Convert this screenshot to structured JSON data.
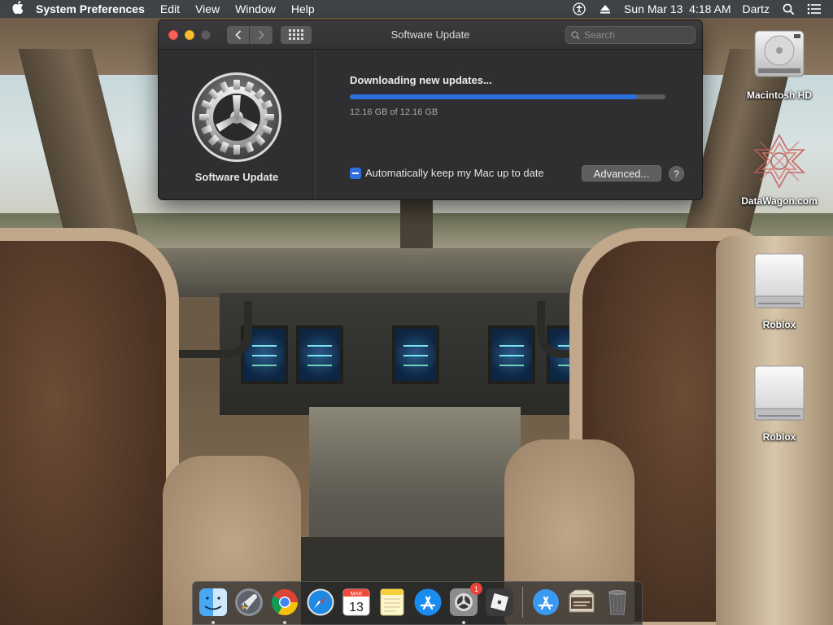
{
  "menubar": {
    "app_name": "System Preferences",
    "menus": [
      "Edit",
      "View",
      "Window",
      "Help"
    ],
    "clock": "Sun Mar 13  4:18 AM",
    "user": "Dartz"
  },
  "window": {
    "title": "Software Update",
    "search_placeholder": "Search",
    "sidebar_label": "Software Update",
    "status": "Downloading new updates...",
    "progress_fraction": 0.91,
    "progress_text": "12.16 GB of 12.16 GB",
    "auto_update_label": "Automatically keep my Mac up to date",
    "advanced_label": "Advanced...",
    "help_label": "?"
  },
  "desktop": {
    "icons": [
      {
        "label": "Macintosh HD",
        "icon": "hard-drive-icon"
      },
      {
        "label": "DataWagon.com",
        "icon": "web-link-icon"
      },
      {
        "label": "Roblox",
        "icon": "disk-image-icon"
      },
      {
        "label": "Roblox",
        "icon": "disk-image-icon"
      }
    ]
  },
  "dock": {
    "calendar_month": "MAR",
    "calendar_day": "13",
    "system_prefs_badge": "1",
    "apps": [
      "Finder",
      "Launchpad",
      "Chrome",
      "Safari",
      "Calendar",
      "Notes",
      "App Store",
      "System Preferences",
      "Roblox",
      "App Store Downloads",
      "Desktop Stack",
      "Trash"
    ]
  },
  "colors": {
    "accent": "#2a6fdb",
    "window_bg": "#2f2f31",
    "close": "#fe5f57",
    "minimize": "#febc2e"
  }
}
